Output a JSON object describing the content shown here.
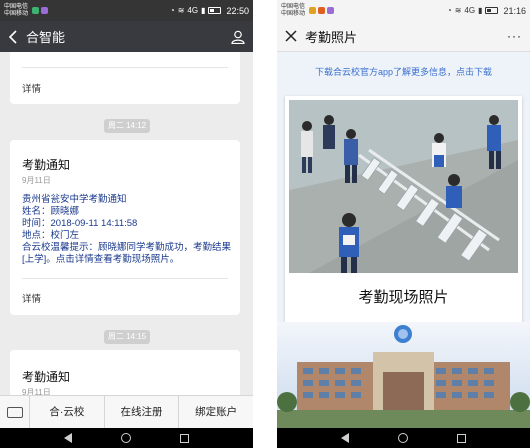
{
  "left": {
    "status": {
      "carrier_line1": "中国电信",
      "carrier_line2": "中国移动",
      "signal": "4G",
      "time": "22:50"
    },
    "header": {
      "title": "合智能",
      "back_icon": "chevron-left-icon",
      "profile_icon": "person-icon"
    },
    "feed": {
      "partial_card": {
        "detail_link": "详情"
      },
      "timestamps": [
        "周二 14:12",
        "周二 14:15"
      ],
      "notice": {
        "title": "考勤通知",
        "date": "9月11日",
        "school": "贵州省瓮安中学考勤通知",
        "name_label": "姓名：",
        "name": "顾晓娜",
        "time_label": "时间：",
        "time": "2018-09-11 14:11:58",
        "place_label": "地点：",
        "place": "校门左",
        "reminder": "合云校温馨提示：顾晓娜同学考勤成功，考勤结果[上学]。点击详情查看考勤现场照片。",
        "detail_link": "详情"
      },
      "second_card": {
        "title": "考勤通知",
        "date": "9月11日"
      }
    },
    "bottom_menu": {
      "keyboard_icon": "keyboard-icon",
      "items": [
        "合·云校",
        "在线注册",
        "绑定账户"
      ]
    }
  },
  "right": {
    "status": {
      "carrier_line1": "中国电信",
      "carrier_line2": "中国移动",
      "signal": "4G",
      "time": "21:16"
    },
    "header": {
      "title": "考勤照片",
      "close_icon": "close-icon",
      "more_icon": "more-icon",
      "more_glyph": "···"
    },
    "download_prompt": "下载合云校官方app了解更多信息，点击下载",
    "photo_caption": "考勤现场照片"
  },
  "colors": {
    "wechat_titlebar": "#393a3f",
    "link_blue": "#1a3a8c",
    "download_blue": "#3a6fd0"
  }
}
